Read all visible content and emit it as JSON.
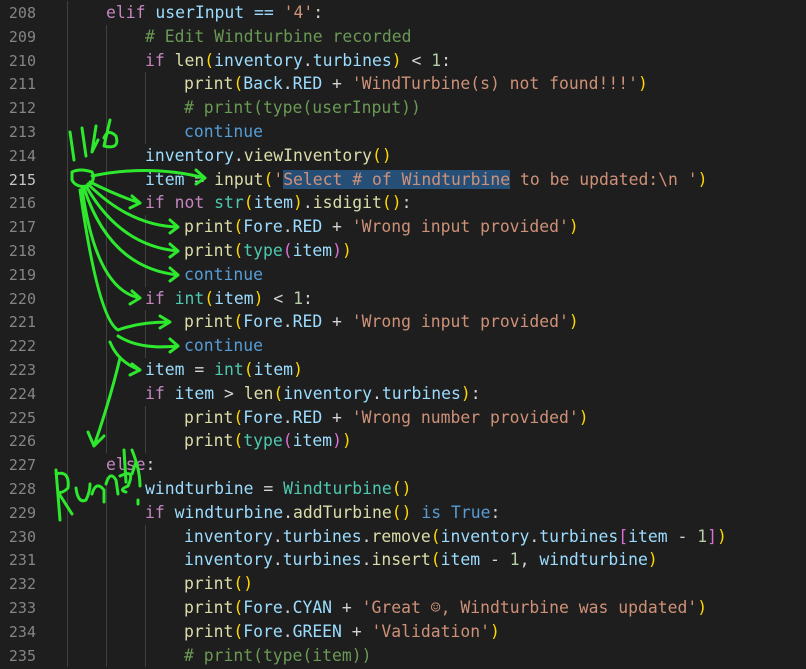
{
  "editor": {
    "active_line": 215,
    "lines": [
      {
        "n": 208,
        "indent": 1,
        "tokens": [
          {
            "t": "elif",
            "c": "ctl"
          },
          {
            "t": " userInput == ",
            "c": "var"
          },
          {
            "t": "'4'",
            "c": "str"
          },
          {
            "t": ":",
            "c": "op"
          }
        ]
      },
      {
        "n": 209,
        "indent": 2,
        "tokens": [
          {
            "t": "# Edit Windturbine recorded",
            "c": "cmt"
          }
        ]
      },
      {
        "n": 210,
        "indent": 2,
        "tokens": [
          {
            "t": "if ",
            "c": "ctl"
          },
          {
            "t": "len",
            "c": "fn"
          },
          {
            "t": "(",
            "c": "br1"
          },
          {
            "t": "inventory",
            "c": "var"
          },
          {
            "t": ".",
            "c": "op"
          },
          {
            "t": "turbines",
            "c": "var"
          },
          {
            "t": ")",
            "c": "br1"
          },
          {
            "t": " < ",
            "c": "op"
          },
          {
            "t": "1",
            "c": "num"
          },
          {
            "t": ":",
            "c": "op"
          }
        ]
      },
      {
        "n": 211,
        "indent": 3,
        "tokens": [
          {
            "t": "print",
            "c": "fn"
          },
          {
            "t": "(",
            "c": "br1"
          },
          {
            "t": "Back",
            "c": "var"
          },
          {
            "t": ".",
            "c": "op"
          },
          {
            "t": "RED",
            "c": "var"
          },
          {
            "t": " + ",
            "c": "op"
          },
          {
            "t": "'WindTurbine(s) not found!!!'",
            "c": "str"
          },
          {
            "t": ")",
            "c": "br1"
          }
        ]
      },
      {
        "n": 212,
        "indent": 3,
        "tokens": [
          {
            "t": "# print(type(userInput))",
            "c": "cmt"
          }
        ]
      },
      {
        "n": 213,
        "indent": 3,
        "tokens": [
          {
            "t": "continue",
            "c": "const"
          }
        ]
      },
      {
        "n": 214,
        "indent": 2,
        "tokens": [
          {
            "t": "inventory",
            "c": "var"
          },
          {
            "t": ".",
            "c": "op"
          },
          {
            "t": "viewInventory",
            "c": "fn"
          },
          {
            "t": "()",
            "c": "br1"
          }
        ]
      },
      {
        "n": 215,
        "indent": 2,
        "tokens": [
          {
            "t": "item",
            "c": "var"
          },
          {
            "t": " = ",
            "c": "op"
          },
          {
            "t": "input",
            "c": "fn"
          },
          {
            "t": "(",
            "c": "br1"
          },
          {
            "t": "'",
            "c": "str"
          },
          {
            "t": "Select # of Windturbine",
            "c": "str",
            "sel": true
          },
          {
            "t": " to be updated:\\n '",
            "c": "str"
          },
          {
            "t": ")",
            "c": "br1"
          }
        ]
      },
      {
        "n": 216,
        "indent": 2,
        "tokens": [
          {
            "t": "if not ",
            "c": "ctl"
          },
          {
            "t": "str",
            "c": "cls"
          },
          {
            "t": "(",
            "c": "br1"
          },
          {
            "t": "item",
            "c": "var"
          },
          {
            "t": ")",
            "c": "br1"
          },
          {
            "t": ".",
            "c": "op"
          },
          {
            "t": "isdigit",
            "c": "fn"
          },
          {
            "t": "()",
            "c": "br1"
          },
          {
            "t": ":",
            "c": "op"
          }
        ]
      },
      {
        "n": 217,
        "indent": 3,
        "tokens": [
          {
            "t": "print",
            "c": "fn"
          },
          {
            "t": "(",
            "c": "br1"
          },
          {
            "t": "Fore",
            "c": "var"
          },
          {
            "t": ".",
            "c": "op"
          },
          {
            "t": "RED",
            "c": "var"
          },
          {
            "t": " + ",
            "c": "op"
          },
          {
            "t": "'Wrong input provided'",
            "c": "str"
          },
          {
            "t": ")",
            "c": "br1"
          }
        ]
      },
      {
        "n": 218,
        "indent": 3,
        "tokens": [
          {
            "t": "print",
            "c": "fn"
          },
          {
            "t": "(",
            "c": "br1"
          },
          {
            "t": "type",
            "c": "cls"
          },
          {
            "t": "(",
            "c": "br2"
          },
          {
            "t": "item",
            "c": "var"
          },
          {
            "t": ")",
            "c": "br2"
          },
          {
            "t": ")",
            "c": "br1"
          }
        ]
      },
      {
        "n": 219,
        "indent": 3,
        "tokens": [
          {
            "t": "continue",
            "c": "const"
          }
        ]
      },
      {
        "n": 220,
        "indent": 2,
        "tokens": [
          {
            "t": "if ",
            "c": "ctl"
          },
          {
            "t": "int",
            "c": "cls"
          },
          {
            "t": "(",
            "c": "br1"
          },
          {
            "t": "item",
            "c": "var"
          },
          {
            "t": ")",
            "c": "br1"
          },
          {
            "t": " < ",
            "c": "op"
          },
          {
            "t": "1",
            "c": "num"
          },
          {
            "t": ":",
            "c": "op"
          }
        ]
      },
      {
        "n": 221,
        "indent": 3,
        "tokens": [
          {
            "t": "print",
            "c": "fn"
          },
          {
            "t": "(",
            "c": "br1"
          },
          {
            "t": "Fore",
            "c": "var"
          },
          {
            "t": ".",
            "c": "op"
          },
          {
            "t": "RED",
            "c": "var"
          },
          {
            "t": " + ",
            "c": "op"
          },
          {
            "t": "'Wrong input provided'",
            "c": "str"
          },
          {
            "t": ")",
            "c": "br1"
          }
        ]
      },
      {
        "n": 222,
        "indent": 3,
        "tokens": [
          {
            "t": "continue",
            "c": "const"
          }
        ]
      },
      {
        "n": 223,
        "indent": 2,
        "tokens": [
          {
            "t": "item",
            "c": "var"
          },
          {
            "t": " = ",
            "c": "op"
          },
          {
            "t": "int",
            "c": "cls"
          },
          {
            "t": "(",
            "c": "br1"
          },
          {
            "t": "item",
            "c": "var"
          },
          {
            "t": ")",
            "c": "br1"
          }
        ]
      },
      {
        "n": 224,
        "indent": 2,
        "tokens": [
          {
            "t": "if ",
            "c": "ctl"
          },
          {
            "t": "item",
            "c": "var"
          },
          {
            "t": " > ",
            "c": "op"
          },
          {
            "t": "len",
            "c": "fn"
          },
          {
            "t": "(",
            "c": "br1"
          },
          {
            "t": "inventory",
            "c": "var"
          },
          {
            "t": ".",
            "c": "op"
          },
          {
            "t": "turbines",
            "c": "var"
          },
          {
            "t": ")",
            "c": "br1"
          },
          {
            "t": ":",
            "c": "op"
          }
        ]
      },
      {
        "n": 225,
        "indent": 3,
        "tokens": [
          {
            "t": "print",
            "c": "fn"
          },
          {
            "t": "(",
            "c": "br1"
          },
          {
            "t": "Fore",
            "c": "var"
          },
          {
            "t": ".",
            "c": "op"
          },
          {
            "t": "RED",
            "c": "var"
          },
          {
            "t": " + ",
            "c": "op"
          },
          {
            "t": "'Wrong number provided'",
            "c": "str"
          },
          {
            "t": ")",
            "c": "br1"
          }
        ]
      },
      {
        "n": 226,
        "indent": 3,
        "tokens": [
          {
            "t": "print",
            "c": "fn"
          },
          {
            "t": "(",
            "c": "br1"
          },
          {
            "t": "type",
            "c": "cls"
          },
          {
            "t": "(",
            "c": "br2"
          },
          {
            "t": "item",
            "c": "var"
          },
          {
            "t": ")",
            "c": "br2"
          },
          {
            "t": ")",
            "c": "br1"
          }
        ]
      },
      {
        "n": 227,
        "indent": 1,
        "tokens": [
          {
            "t": "else",
            "c": "ctl"
          },
          {
            "t": ":",
            "c": "op"
          }
        ]
      },
      {
        "n": 228,
        "indent": 2,
        "tokens": [
          {
            "t": "windturbine",
            "c": "var"
          },
          {
            "t": " = ",
            "c": "op"
          },
          {
            "t": "Windturbine",
            "c": "cls"
          },
          {
            "t": "()",
            "c": "br1"
          }
        ]
      },
      {
        "n": 229,
        "indent": 2,
        "tokens": [
          {
            "t": "if ",
            "c": "ctl"
          },
          {
            "t": "windturbine",
            "c": "var"
          },
          {
            "t": ".",
            "c": "op"
          },
          {
            "t": "addTurbine",
            "c": "fn"
          },
          {
            "t": "()",
            "c": "br1"
          },
          {
            "t": " is ",
            "c": "const"
          },
          {
            "t": "True",
            "c": "const"
          },
          {
            "t": ":",
            "c": "op"
          }
        ]
      },
      {
        "n": 230,
        "indent": 3,
        "tokens": [
          {
            "t": "inventory",
            "c": "var"
          },
          {
            "t": ".",
            "c": "op"
          },
          {
            "t": "turbines",
            "c": "var"
          },
          {
            "t": ".",
            "c": "op"
          },
          {
            "t": "remove",
            "c": "fn"
          },
          {
            "t": "(",
            "c": "br1"
          },
          {
            "t": "inventory",
            "c": "var"
          },
          {
            "t": ".",
            "c": "op"
          },
          {
            "t": "turbines",
            "c": "var"
          },
          {
            "t": "[",
            "c": "br2"
          },
          {
            "t": "item",
            "c": "var"
          },
          {
            "t": " - ",
            "c": "op"
          },
          {
            "t": "1",
            "c": "num"
          },
          {
            "t": "]",
            "c": "br2"
          },
          {
            "t": ")",
            "c": "br1"
          }
        ]
      },
      {
        "n": 231,
        "indent": 3,
        "tokens": [
          {
            "t": "inventory",
            "c": "var"
          },
          {
            "t": ".",
            "c": "op"
          },
          {
            "t": "turbines",
            "c": "var"
          },
          {
            "t": ".",
            "c": "op"
          },
          {
            "t": "insert",
            "c": "fn"
          },
          {
            "t": "(",
            "c": "br1"
          },
          {
            "t": "item",
            "c": "var"
          },
          {
            "t": " - ",
            "c": "op"
          },
          {
            "t": "1",
            "c": "num"
          },
          {
            "t": ", ",
            "c": "op"
          },
          {
            "t": "windturbine",
            "c": "var"
          },
          {
            "t": ")",
            "c": "br1"
          }
        ]
      },
      {
        "n": 232,
        "indent": 3,
        "tokens": [
          {
            "t": "print",
            "c": "fn"
          },
          {
            "t": "()",
            "c": "br1"
          }
        ]
      },
      {
        "n": 233,
        "indent": 3,
        "tokens": [
          {
            "t": "print",
            "c": "fn"
          },
          {
            "t": "(",
            "c": "br1"
          },
          {
            "t": "Fore",
            "c": "var"
          },
          {
            "t": ".",
            "c": "op"
          },
          {
            "t": "CYAN",
            "c": "var"
          },
          {
            "t": " + ",
            "c": "op"
          },
          {
            "t": "'Great ☺, Windturbine was updated'",
            "c": "str"
          },
          {
            "t": ")",
            "c": "br1"
          }
        ]
      },
      {
        "n": 234,
        "indent": 3,
        "tokens": [
          {
            "t": "print",
            "c": "fn"
          },
          {
            "t": "(",
            "c": "br1"
          },
          {
            "t": "Fore",
            "c": "var"
          },
          {
            "t": ".",
            "c": "op"
          },
          {
            "t": "GREEN",
            "c": "var"
          },
          {
            "t": " + ",
            "c": "op"
          },
          {
            "t": "'Validation'",
            "c": "str"
          },
          {
            "t": ")",
            "c": "br1"
          }
        ]
      },
      {
        "n": 235,
        "indent": 3,
        "tokens": [
          {
            "t": "# print(type(item))",
            "c": "cmt"
          }
        ]
      }
    ]
  },
  "annotations": {
    "ink_color": "#2ee82e",
    "top_text": "Like",
    "bottom_text": "Runned!"
  }
}
